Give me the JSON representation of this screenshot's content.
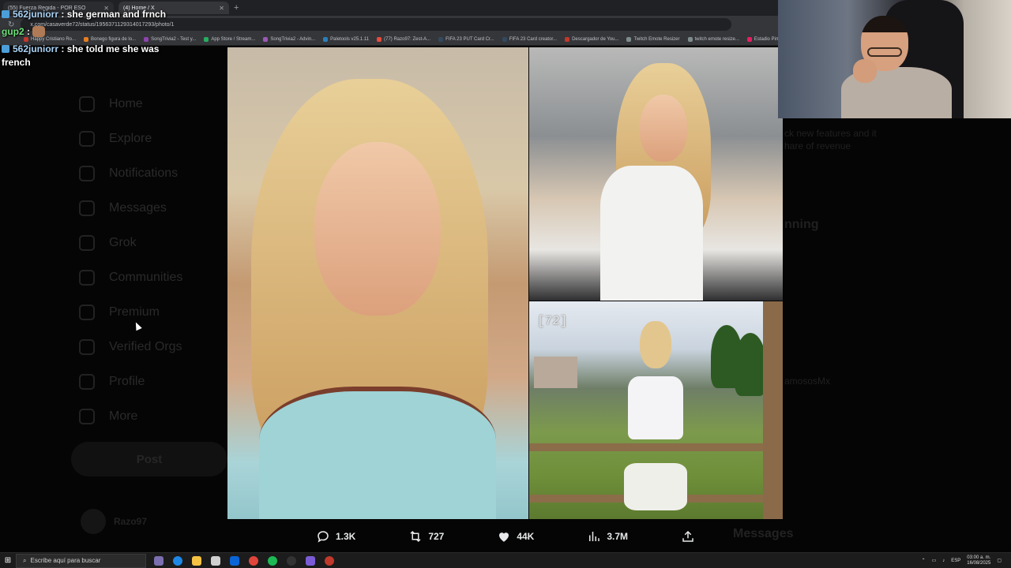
{
  "browser": {
    "tabs": [
      {
        "label": "(55) Fuerza Regida - POR ESO",
        "active": false
      },
      {
        "label": "(4) Home / X",
        "active": true
      }
    ],
    "url": "x.com/casaverde72/status/1956371129314017293/photo/1",
    "bookmarks": [
      {
        "label": "Happy Cristiano Ro...",
        "color": "#c0392b"
      },
      {
        "label": "Bonego figura de lo...",
        "color": "#e67e22"
      },
      {
        "label": "SongTrivia2 - Test y...",
        "color": "#8e44ad"
      },
      {
        "label": "App Store / Stream...",
        "color": "#27ae60"
      },
      {
        "label": "SongTrivia2 - Advin...",
        "color": "#9b59b6"
      },
      {
        "label": "Paletools v25.1.11",
        "color": "#2980b9"
      },
      {
        "label": "(77) Razo97: Zest-A...",
        "color": "#e74c3c"
      },
      {
        "label": "FIFA 23 PUT Card Cr...",
        "color": "#34495e"
      },
      {
        "label": "FIFA 23 Card creator...",
        "color": "#34495e"
      },
      {
        "label": "Descargador de You...",
        "color": "#c0392b"
      },
      {
        "label": "Twitch Emote Resizer",
        "color": "#7f8c8d"
      },
      {
        "label": "twitch emote resize...",
        "color": "#7f8c8d"
      },
      {
        "label": "Estadio Pim...",
        "color": "#e91e63"
      }
    ]
  },
  "chat": [
    {
      "user": "562juniorr",
      "text": "she german and frnch",
      "badge": true
    },
    {
      "user": "gup2",
      "text": "",
      "emote": true
    },
    {
      "user": "562juniorr",
      "text": "she told me she was french",
      "badge": true
    }
  ],
  "sidebar": {
    "items": [
      "Home",
      "Explore",
      "Notifications",
      "Messages",
      "Grok",
      "Communities",
      "Premium",
      "Verified Orgs",
      "Profile",
      "More"
    ],
    "post_label": "Post",
    "username": "Razo97"
  },
  "right_panel": {
    "line1": "ck new features and it",
    "line2": "hare of revenue",
    "trending": "nning",
    "handle": "amososMx"
  },
  "photo3_label": "[72]",
  "actions": {
    "replies": "1.3K",
    "reposts": "727",
    "likes": "44K",
    "views": "3.7M"
  },
  "messages_label": "Messages",
  "taskbar": {
    "search_placeholder": "Escribe aquí para buscar",
    "lang": "ESP",
    "time": "03:00 a. m.",
    "date": "16/08/2025"
  }
}
